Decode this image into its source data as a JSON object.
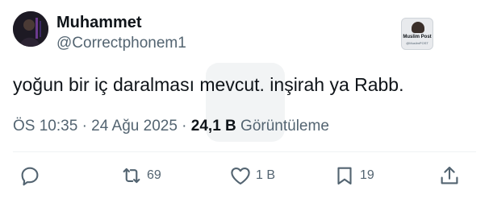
{
  "author": {
    "display_name": "Muhammet",
    "handle": "@Correctphonem1",
    "avatar_icon": "user-avatar"
  },
  "badge": {
    "title": "Muslim Post",
    "subtitle": "@MuslimPOST"
  },
  "tweet": {
    "text": "yoğun bir iç daralması mevcut. inşirah ya Rabb."
  },
  "meta": {
    "time": "ÖS 10:35",
    "separator1": "·",
    "date": "24 Ağu 2025",
    "separator2": "·",
    "views": "24,1 B",
    "views_label": "Görüntüleme"
  },
  "actions": {
    "reply": {
      "icon": "reply-icon",
      "count": ""
    },
    "retweet": {
      "icon": "retweet-icon",
      "count": "69"
    },
    "like": {
      "icon": "heart-icon",
      "count": "1 B"
    },
    "bookmark": {
      "icon": "bookmark-icon",
      "count": "19"
    },
    "share": {
      "icon": "share-icon"
    }
  },
  "colors": {
    "text_primary": "#0f1419",
    "text_secondary": "#536471",
    "divider": "#eff3f4"
  }
}
